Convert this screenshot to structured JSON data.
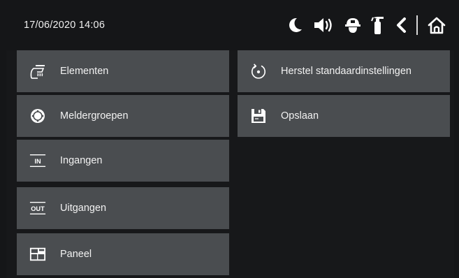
{
  "status": {
    "datetime": "17/06/2020  14:06",
    "icons": [
      "moon-icon",
      "speaker-icon",
      "firefighter-helmet-icon",
      "fire-extinguisher-icon",
      "back-arrow-icon",
      "home-icon"
    ]
  },
  "menu": {
    "left": [
      {
        "label": "Elementen",
        "icon": "heat-detector-icon"
      },
      {
        "label": "Meldergroepen",
        "icon": "detector-group-icon"
      },
      {
        "label": "Ingangen",
        "icon": "input-icon",
        "icon_text": "IN"
      },
      {
        "label": "Uitgangen",
        "icon": "output-icon",
        "icon_text": "OUT"
      },
      {
        "label": "Paneel",
        "icon": "panel-icon"
      }
    ],
    "right": [
      {
        "label": "Herstel standaardinstellingen",
        "icon": "reset-icon"
      },
      {
        "label": "Opslaan",
        "icon": "save-icon"
      }
    ]
  },
  "colors": {
    "background": "#151618",
    "tile": "#4a4d50",
    "text": "#f2f2f2"
  }
}
